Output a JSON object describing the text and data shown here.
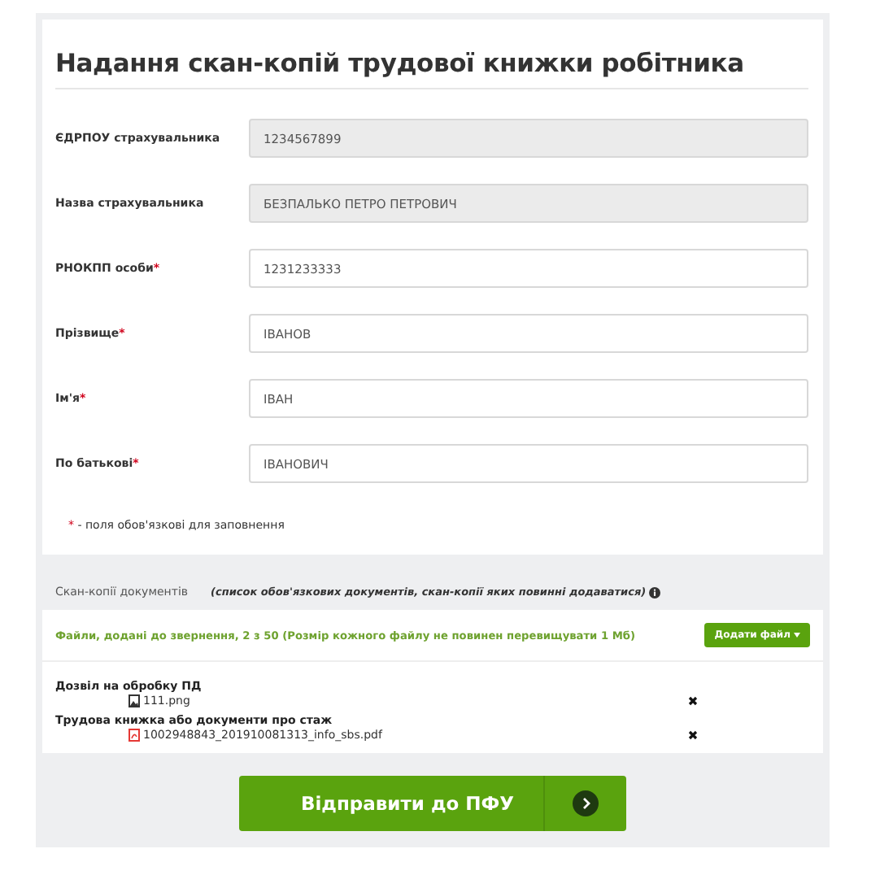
{
  "title": "Надання скан-копій трудової книжки робітника",
  "fields": [
    {
      "label": "ЄДРПОУ страхувальника",
      "value": "1234567899",
      "required": false,
      "disabled": true
    },
    {
      "label": "Назва страхувальника",
      "value": "БЕЗПАЛЬКО ПЕТРО ПЕТРОВИЧ",
      "required": false,
      "disabled": true
    },
    {
      "label": "РНОКПП особи",
      "value": "1231233333",
      "required": true,
      "disabled": false
    },
    {
      "label": "Прізвище",
      "value": "ІВАНОВ",
      "required": true,
      "disabled": false
    },
    {
      "label": "Ім'я",
      "value": "ІВАН",
      "required": true,
      "disabled": false
    },
    {
      "label": "По батькові",
      "value": "ІВАНОВИЧ",
      "required": true,
      "disabled": false
    }
  ],
  "required_note": {
    "mark": "*",
    "text": " - поля обов'язкові для заповнення"
  },
  "documents": {
    "title": "Скан-копії документів",
    "hint": "(список обов'язкових документів, скан-копії яких повинні додаватися)",
    "files_caption": "Файли, додані до звернення, 2 з 50 (Розмір кожного файлу не повинен перевищувати 1 Мб)",
    "add_button": "Додати файл",
    "groups": [
      {
        "name": "Дозвіл на обробку ПД",
        "files": [
          {
            "name": "111.png",
            "kind": "image"
          }
        ]
      },
      {
        "name": "Трудова книжка або документи про стаж",
        "files": [
          {
            "name": "1002948843_201910081313_info_sbs.pdf",
            "kind": "pdf"
          }
        ]
      }
    ]
  },
  "submit_button": "Відправити до ПФУ"
}
